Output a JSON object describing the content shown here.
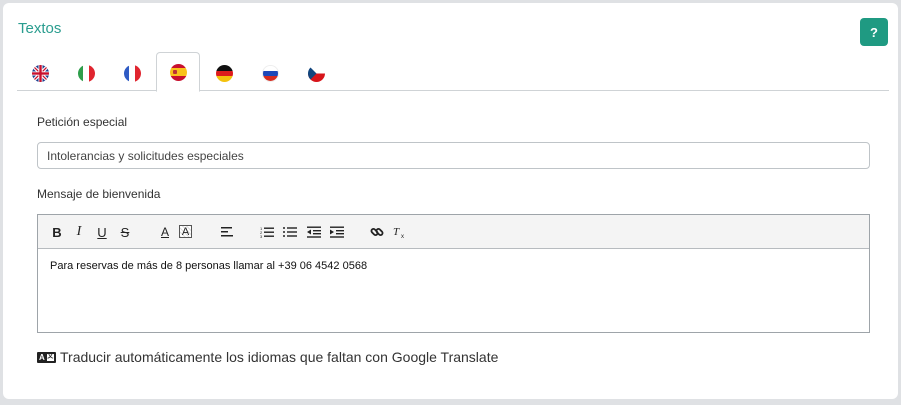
{
  "section": {
    "title": "Textos",
    "help_label": "?"
  },
  "tabs": [
    {
      "lang": "en",
      "icon": "uk-flag-icon"
    },
    {
      "lang": "it",
      "icon": "italy-flag-icon"
    },
    {
      "lang": "fr",
      "icon": "france-flag-icon"
    },
    {
      "lang": "es",
      "icon": "spain-flag-icon",
      "active": true
    },
    {
      "lang": "de",
      "icon": "germany-flag-icon"
    },
    {
      "lang": "ru",
      "icon": "russia-flag-icon"
    },
    {
      "lang": "cz",
      "icon": "czech-flag-icon"
    }
  ],
  "special_request": {
    "label": "Petición especial",
    "value": "Intolerancias y solicitudes especiales"
  },
  "welcome_message": {
    "label": "Mensaje de bienvenida",
    "content": "Para reservas de más de 8 personas llamar al +39 06 4542 0568"
  },
  "toolbar": {
    "bold": "B",
    "italic": "I",
    "underline": "U",
    "strike": "S",
    "font_color": "A",
    "bg_color": "A"
  },
  "auto_translate": {
    "icon": "translate-icon",
    "label": "Traducir automáticamente los idiomas que faltan con Google Translate"
  },
  "colors": {
    "accent": "#1f9a82",
    "title": "#2a9d8f"
  }
}
